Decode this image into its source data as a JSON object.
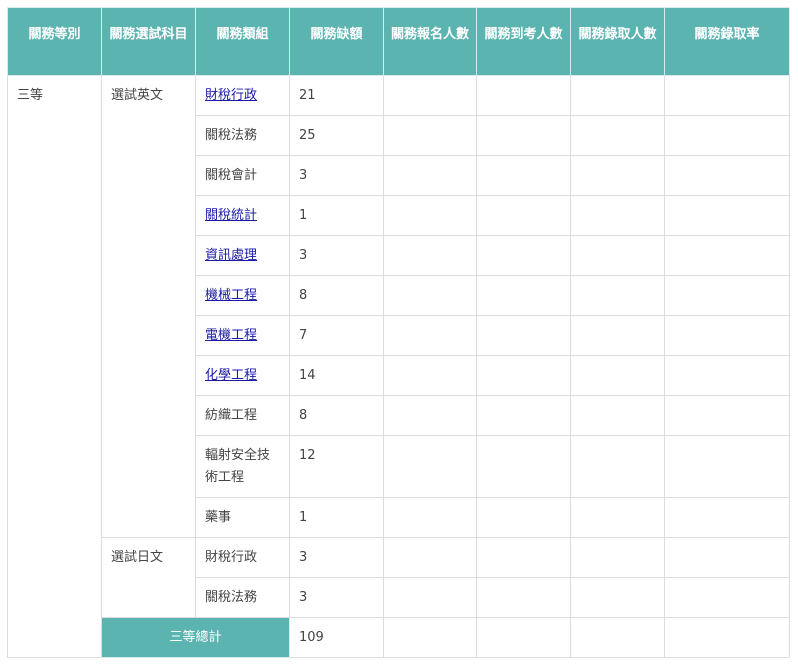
{
  "headers": [
    "關務等別",
    "關務選試科目",
    "關務類組",
    "關務缺額",
    "關務報名人數",
    "關務到考人數",
    "關務錄取人數",
    "關務錄取率"
  ],
  "grade": "三等",
  "subjects": [
    "選試英文",
    "選試日文"
  ],
  "groups": [
    {
      "name": "財稅行政",
      "link": true,
      "quota": "21"
    },
    {
      "name": "關稅法務",
      "link": false,
      "quota": "25"
    },
    {
      "name": "關稅會計",
      "link": false,
      "quota": "3"
    },
    {
      "name": "關稅統計",
      "link": true,
      "quota": "1"
    },
    {
      "name": "資訊處理",
      "link": true,
      "quota": "3"
    },
    {
      "name": "機械工程",
      "link": true,
      "quota": "8"
    },
    {
      "name": "電機工程",
      "link": true,
      "quota": "7"
    },
    {
      "name": "化學工程",
      "link": true,
      "quota": "14"
    },
    {
      "name": "紡織工程",
      "link": false,
      "quota": "8"
    },
    {
      "name": "輻射安全技術工程",
      "link": false,
      "quota": "12"
    },
    {
      "name": "藥事",
      "link": false,
      "quota": "1"
    },
    {
      "name": "財稅行政",
      "link": false,
      "quota": "3"
    },
    {
      "name": "關稅法務",
      "link": false,
      "quota": "3"
    }
  ],
  "total": {
    "label": "三等總計",
    "quota": "109"
  },
  "colors": {
    "header_bg": "#5cb4b1",
    "header_text": "#ffffff",
    "link": "#1a1aa6",
    "border": "#d9dddf"
  }
}
